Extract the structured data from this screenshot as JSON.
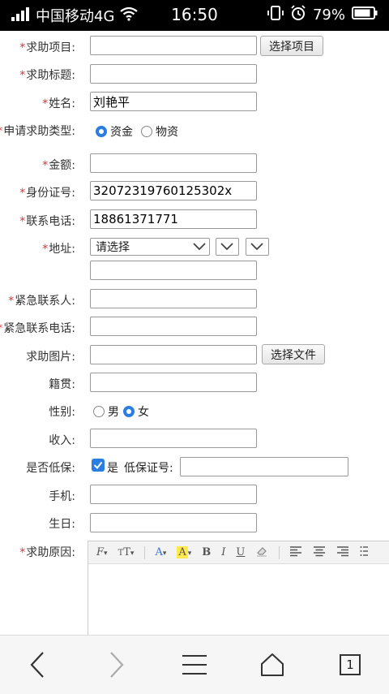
{
  "status": {
    "carrier": "中国移动4G",
    "time": "16:50",
    "battery": "79%"
  },
  "form": {
    "project_label": "求助项目:",
    "project_value": "",
    "select_project_btn": "选择项目",
    "title_label": "求助标题:",
    "title_value": "",
    "name_label": "姓名:",
    "name_value": "刘艳平",
    "type_label": "申请求助类型:",
    "type_options": [
      "资金",
      "物资"
    ],
    "amount_label": "金额:",
    "amount_value": "",
    "id_label": "身份证号:",
    "id_value": "32072319760125302x",
    "phone_label": "联系电话:",
    "phone_value": "18861371771",
    "address_label": "地址:",
    "address_select": "请选择",
    "address_detail": "",
    "emergency_label": "紧急联系人:",
    "emergency_value": "",
    "emergency_phone_label": "紧急联系电话:",
    "emergency_phone_value": "",
    "image_label": "求助图片:",
    "image_value": "",
    "select_file_btn": "选择文件",
    "native_label": "籍贯:",
    "native_value": "",
    "gender_label": "性别:",
    "gender_options": [
      "男",
      "女"
    ],
    "income_label": "收入:",
    "income_value": "",
    "lowincome_label": "是否低保:",
    "lowincome_yes": "是",
    "lowincome_cert_label": "低保证号:",
    "lowincome_cert_value": "",
    "mobile_label": "手机:",
    "mobile_value": "",
    "birthday_label": "生日:",
    "birthday_value": "",
    "reason_label": "求助原因:"
  },
  "editor_toolbar": {
    "font_family": "F",
    "font_size": "T",
    "font_color": "A",
    "highlight": "A",
    "bold": "B",
    "italic": "I",
    "underline": "U"
  },
  "nav": {
    "tab_count": "1"
  }
}
